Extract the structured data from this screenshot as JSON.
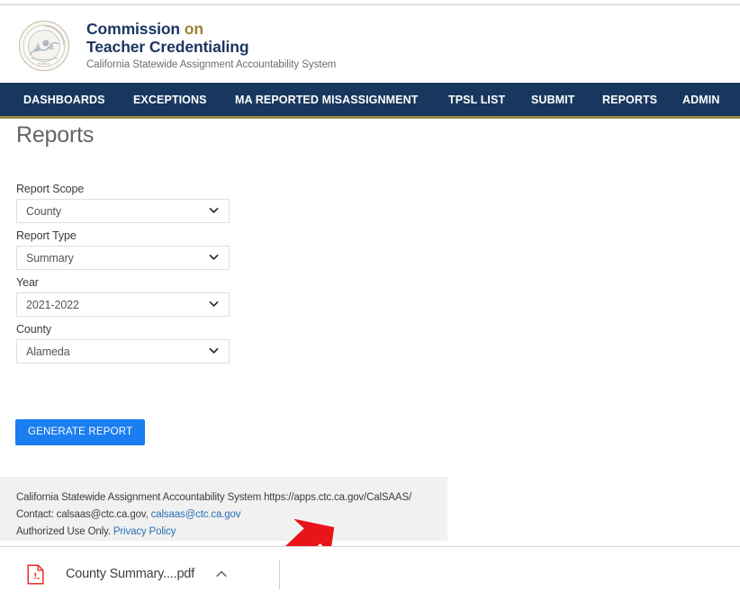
{
  "header": {
    "logo_alt": "california-state-seal",
    "title_line1_main": "Commission",
    "title_line1_accent": "on",
    "title_line2": "Teacher Credentialing",
    "subtitle": "California Statewide Assignment Accountability System"
  },
  "nav": {
    "items": [
      {
        "label": "DASHBOARDS",
        "name": "nav-dashboards"
      },
      {
        "label": "EXCEPTIONS",
        "name": "nav-exceptions"
      },
      {
        "label": "MA REPORTED MISASSIGNMENT",
        "name": "nav-ma-reported-misassignment"
      },
      {
        "label": "TPSL LIST",
        "name": "nav-tpsl-list"
      },
      {
        "label": "SUBMIT",
        "name": "nav-submit"
      },
      {
        "label": "REPORTS",
        "name": "nav-reports"
      },
      {
        "label": "ADMIN",
        "name": "nav-admin"
      }
    ]
  },
  "page": {
    "title": "Reports"
  },
  "form": {
    "fields": [
      {
        "label": "Report Scope",
        "value": "County"
      },
      {
        "label": "Report Type",
        "value": "Summary"
      },
      {
        "label": "Year",
        "value": "2021-2022"
      },
      {
        "label": "County",
        "value": "Alameda"
      }
    ],
    "generate_button": "GENERATE REPORT"
  },
  "footer": {
    "line1": "California Statewide Assignment Accountability System https://apps.ctc.ca.gov/CalSAAS/",
    "line2_prefix": "Contact: calsaas@ctc.ca.gov,",
    "line2_link": "calsaas@ctc.ca.gov",
    "line3_prefix": "Authorized Use Only.",
    "line3_link": "Privacy Policy"
  },
  "download_bar": {
    "file_name": "County Summary....pdf",
    "file_icon": "pdf-file-icon",
    "menu_icon": "chevron-up-icon"
  },
  "annotation": {
    "arrow": "red-arrow-pointing-down-left"
  },
  "colors": {
    "nav_bg": "#17375e",
    "nav_accent": "#9f8c42",
    "brand_navy": "#1c3661",
    "brand_gold": "#9a8433",
    "button_blue": "#1a7ef0",
    "footer_bg": "#f1f1f1",
    "link_blue": "#2a6fb5",
    "arrow_red": "#e8141a"
  }
}
